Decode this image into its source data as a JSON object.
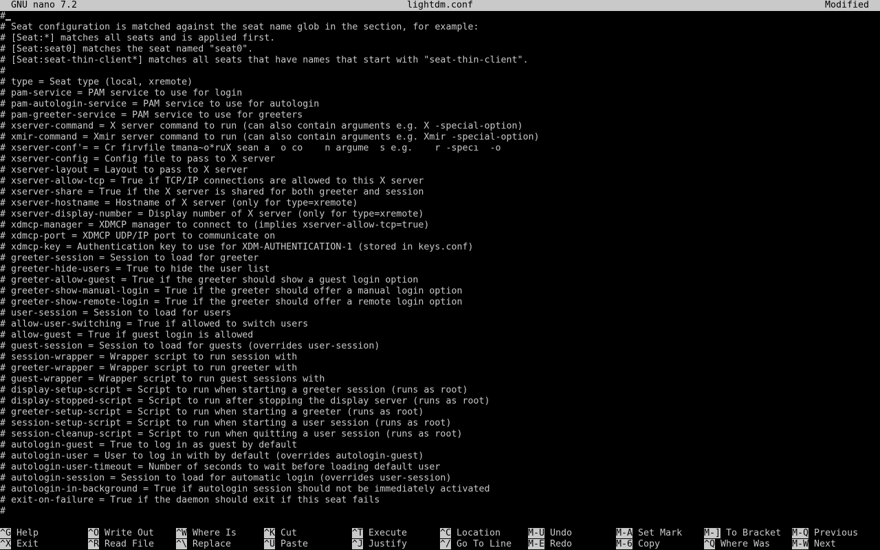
{
  "titlebar": {
    "app": "GNU nano 7.2",
    "filename": "lightdm.conf",
    "status": "Modified"
  },
  "editor": {
    "lines": [
      "#",
      "# Seat configuration is matched against the seat name glob in the section, for example:",
      "# [Seat:*] matches all seats and is applied first.",
      "# [Seat:seat0] matches the seat named \"seat0\".",
      "# [Seat:seat-thin-client*] matches all seats that have names that start with \"seat-thin-client\".",
      "#",
      "# type = Seat type (local, xremote)",
      "# pam-service = PAM service to use for login",
      "# pam-autologin-service = PAM service to use for autologin",
      "# pam-greeter-service = PAM service to use for greeters",
      "# xserver-command = X server command to run (can also contain arguments e.g. X -special-option)",
      "# xmir-command = Xmir server command to run (can also contain arguments e.g. Xmir -special-option)",
      "# xserver-conf'= = Cr firvfile tmana~o*ruX sean a  o co    n argume  s e.g.    r -specı  -o",
      "# xserver-config = Config file to pass to X server",
      "# xserver-layout = Layout to pass to X server",
      "# xserver-allow-tcp = True if TCP/IP connections are allowed to this X server",
      "# xserver-share = True if the X server is shared for both greeter and session",
      "# xserver-hostname = Hostname of X server (only for type=xremote)",
      "# xserver-display-number = Display number of X server (only for type=xremote)",
      "# xdmcp-manager = XDMCP manager to connect to (implies xserver-allow-tcp=true)",
      "# xdmcp-port = XDMCP UDP/IP port to communicate on",
      "# xdmcp-key = Authentication key to use for XDM-AUTHENTICATION-1 (stored in keys.conf)",
      "# greeter-session = Session to load for greeter",
      "# greeter-hide-users = True to hide the user list",
      "# greeter-allow-guest = True if the greeter should show a guest login option",
      "# greeter-show-manual-login = True if the greeter should offer a manual login option",
      "# greeter-show-remote-login = True if the greeter should offer a remote login option",
      "# user-session = Session to load for users",
      "# allow-user-switching = True if allowed to switch users",
      "# allow-guest = True if guest login is allowed",
      "# guest-session = Session to load for guests (overrides user-session)",
      "# session-wrapper = Wrapper script to run session with",
      "# greeter-wrapper = Wrapper script to run greeter with",
      "# guest-wrapper = Wrapper script to run guest sessions with",
      "# display-setup-script = Script to run when starting a greeter session (runs as root)",
      "# display-stopped-script = Script to run after stopping the display server (runs as root)",
      "# greeter-setup-script = Script to run when starting a greeter (runs as root)",
      "# session-setup-script = Script to run when starting a user session (runs as root)",
      "# session-cleanup-script = Script to run when quitting a user session (runs as root)",
      "# autologin-guest = True to log in as guest by default",
      "# autologin-user = User to log in with by default (overrides autologin-guest)",
      "# autologin-user-timeout = Number of seconds to wait before loading default user",
      "# autologin-session = Session to load for automatic login (overrides user-session)",
      "# autologin-in-background = True if autologin session should not be immediately activated",
      "# exit-on-failure = True if the daemon should exit if this seat fails",
      "#"
    ]
  },
  "shortcuts": {
    "row1": [
      {
        "key": "^G",
        "label": "Help"
      },
      {
        "key": "^O",
        "label": "Write Out"
      },
      {
        "key": "^W",
        "label": "Where Is"
      },
      {
        "key": "^K",
        "label": "Cut"
      },
      {
        "key": "^T",
        "label": "Execute"
      },
      {
        "key": "^C",
        "label": "Location"
      },
      {
        "key": "M-U",
        "label": "Undo"
      },
      {
        "key": "M-A",
        "label": "Set Mark"
      },
      {
        "key": "M-]",
        "label": "To Bracket"
      },
      {
        "key": "M-Q",
        "label": "Previous"
      }
    ],
    "row2": [
      {
        "key": "^X",
        "label": "Exit"
      },
      {
        "key": "^R",
        "label": "Read File"
      },
      {
        "key": "^\\",
        "label": "Replace"
      },
      {
        "key": "^U",
        "label": "Paste"
      },
      {
        "key": "^J",
        "label": "Justify"
      },
      {
        "key": "^/",
        "label": "Go To Line"
      },
      {
        "key": "M-E",
        "label": "Redo"
      },
      {
        "key": "M-6",
        "label": "Copy"
      },
      {
        "key": "^Q",
        "label": "Where Was"
      },
      {
        "key": "M-W",
        "label": "Next"
      }
    ]
  }
}
